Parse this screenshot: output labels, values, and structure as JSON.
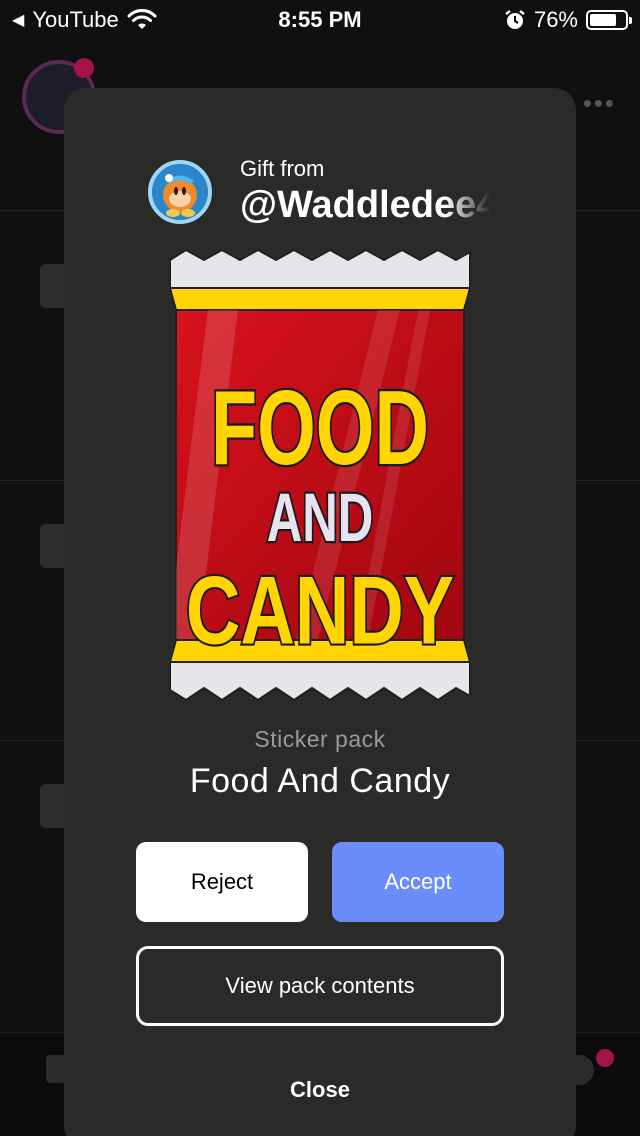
{
  "status_bar": {
    "back_app": "YouTube",
    "time": "8:55 PM",
    "battery": "76%",
    "battery_level": 0.76
  },
  "gift": {
    "from_label": "Gift from",
    "sender": "@Waddledee4"
  },
  "pack": {
    "art_line1": "FOOD",
    "art_line2": "AND",
    "art_line3": "CANDY",
    "type": "Sticker pack",
    "name": "Food And Candy"
  },
  "actions": {
    "reject": "Reject",
    "accept": "Accept",
    "view_contents": "View pack contents",
    "close": "Close"
  },
  "colors": {
    "modal_bg": "#2b2a28",
    "accept": "#6a8ef9",
    "pack_red": "#c8101a",
    "pack_yellow": "#ffd400"
  }
}
